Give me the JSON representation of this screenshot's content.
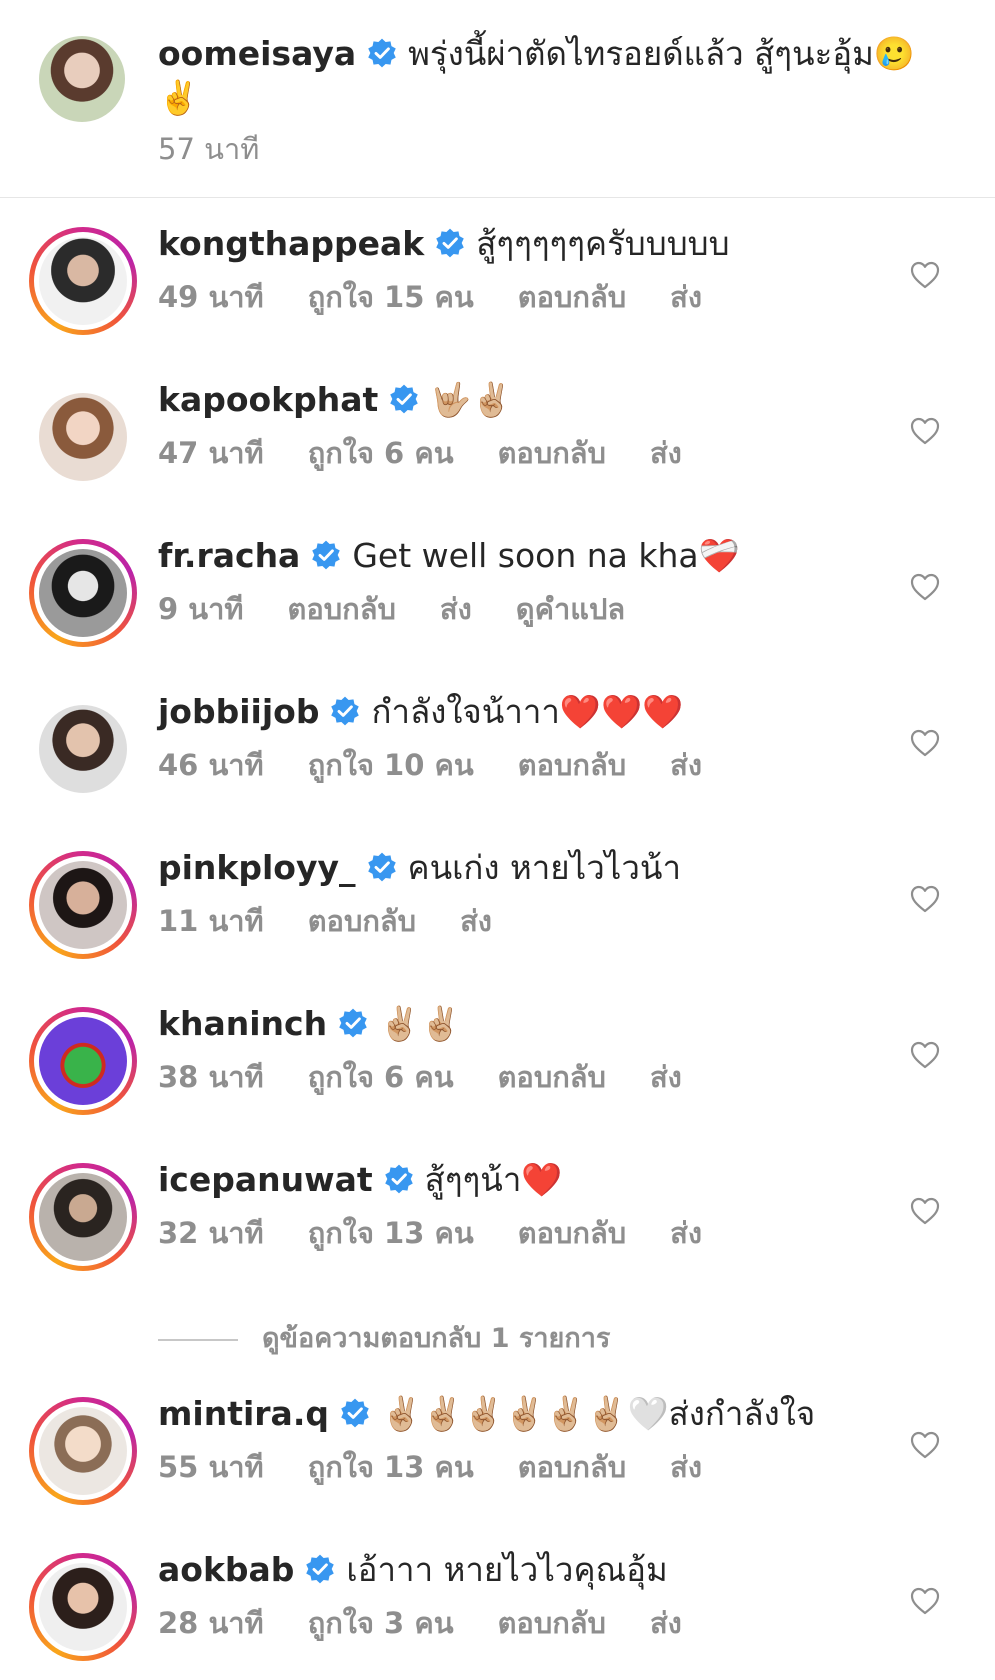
{
  "caption": {
    "username": "oomeisaya",
    "text": "พรุ่งนี้ผ่าตัดไทรอยด์แล้ว สู้ๆนะอุ้ม🥲✌️",
    "time": "57 นาที"
  },
  "comments": [
    {
      "username": "kongthappeak",
      "text": "สู้ๆๆๆๆๆครับบบบบ",
      "time": "49 นาที",
      "likes": "ถูกใจ 15 คน",
      "reply": "ตอบกลับ",
      "send": "ส่ง"
    },
    {
      "username": "kapookphat",
      "text": "🤟🏼✌🏼",
      "time": "47 นาที",
      "likes": "ถูกใจ 6 คน",
      "reply": "ตอบกลับ",
      "send": "ส่ง"
    },
    {
      "username": "fr.racha",
      "text": "Get well soon na kha❤️‍🩹",
      "time": "9 นาที",
      "reply": "ตอบกลับ",
      "send": "ส่ง",
      "translate": "ดูคำแปล"
    },
    {
      "username": "jobbiijob",
      "text": "กำลังใจน้าาา❤️❤️❤️",
      "time": "46 นาที",
      "likes": "ถูกใจ 10 คน",
      "reply": "ตอบกลับ",
      "send": "ส่ง"
    },
    {
      "username": "pinkployy_",
      "text": "คนเก่ง หายไวไวน้า",
      "time": "11 นาที",
      "reply": "ตอบกลับ",
      "send": "ส่ง"
    },
    {
      "username": "khaninch",
      "text": "✌🏼✌🏼",
      "time": "38 นาที",
      "likes": "ถูกใจ 6 คน",
      "reply": "ตอบกลับ",
      "send": "ส่ง"
    },
    {
      "username": "icepanuwat",
      "text": "สู้ๆๆน้า❤️",
      "time": "32 นาที",
      "likes": "ถูกใจ 13 คน",
      "reply": "ตอบกลับ",
      "send": "ส่ง"
    },
    {
      "username": "mintira.q",
      "text": "✌🏼✌🏼✌🏼✌🏼✌🏼✌🏼🤍ส่งกำลังใจ",
      "time": "55 นาที",
      "likes": "ถูกใจ 13 คน",
      "reply": "ตอบกลับ",
      "send": "ส่ง"
    },
    {
      "username": "aokbab",
      "text": "เอ้าาา หายไวไวคุณอุ้ม",
      "time": "28 นาที",
      "likes": "ถูกใจ 3 คน",
      "reply": "ตอบกลับ",
      "send": "ส่ง"
    }
  ],
  "view_replies": "ดูข้อความตอบกลับ 1 รายการ",
  "colors": {
    "verified": "#3897f0",
    "meta": "#8e8e8e",
    "text": "#262626",
    "story_ring_start": "#f9a61b",
    "story_ring_end": "#d22a8a"
  }
}
